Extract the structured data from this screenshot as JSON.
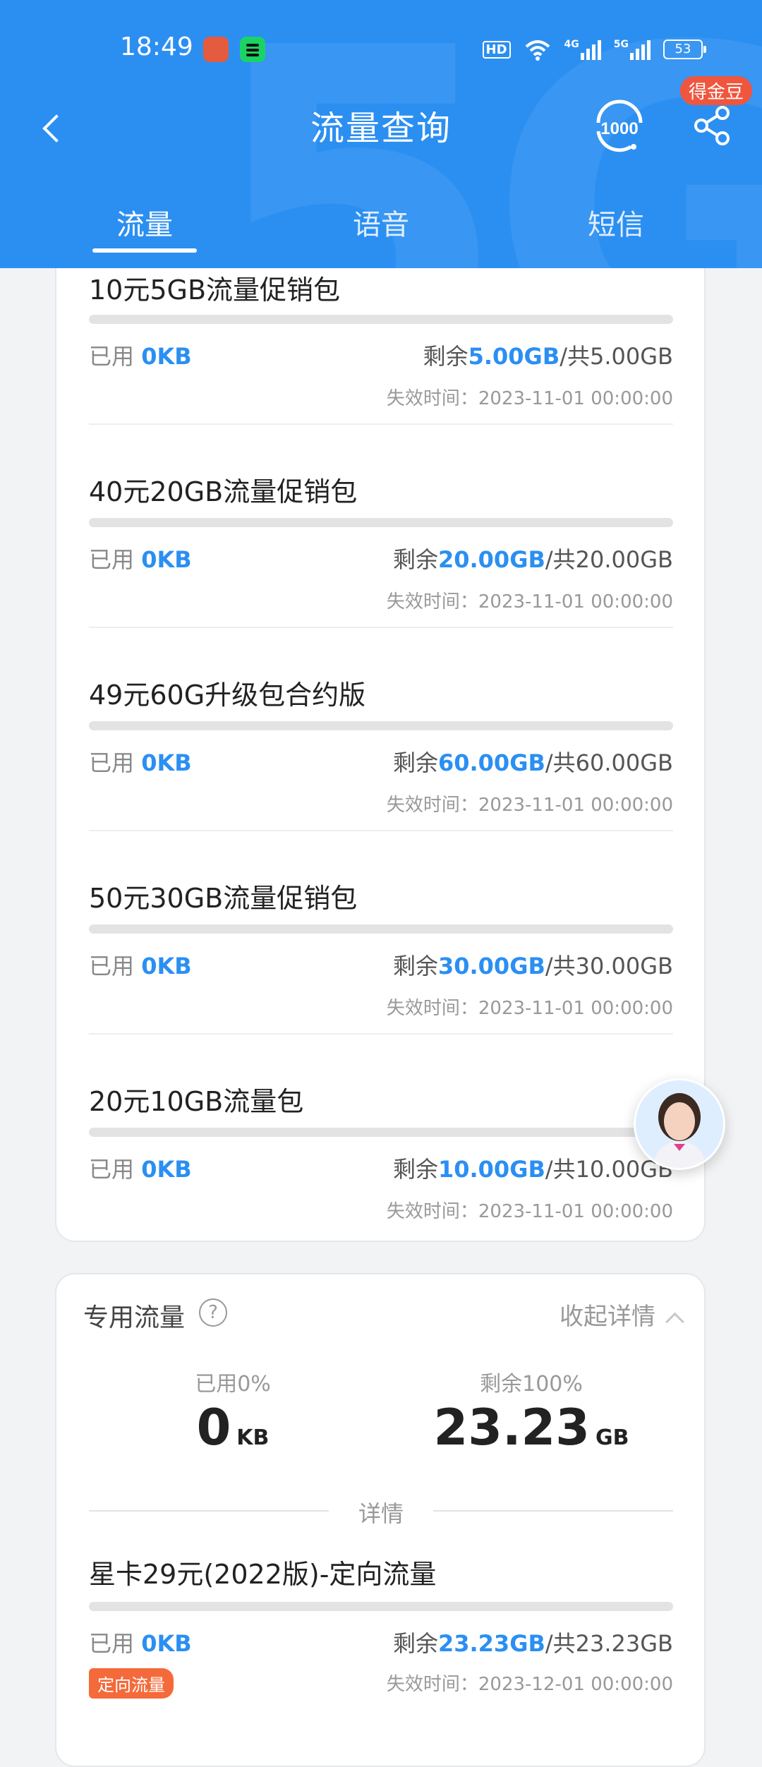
{
  "status_bar": {
    "time": "18:49",
    "hd": "HD",
    "net1": "4G",
    "net2": "5G",
    "battery": "53"
  },
  "header": {
    "title": "流量查询",
    "badge": "得金豆",
    "tabs": [
      {
        "label": "流量",
        "active": true
      },
      {
        "label": "语音",
        "active": false
      },
      {
        "label": "短信",
        "active": false
      }
    ],
    "accent_color": "#2b8ff2"
  },
  "packages": [
    {
      "name": "10元5GB流量促销包",
      "used_label": "已用",
      "used": "0KB",
      "remain_label": "剩余",
      "remain": "5.00GB",
      "total": "/共5.00GB",
      "expire": "失效时间：2023-11-01 00:00:00"
    },
    {
      "name": "40元20GB流量促销包",
      "used_label": "已用",
      "used": "0KB",
      "remain_label": "剩余",
      "remain": "20.00GB",
      "total": "/共20.00GB",
      "expire": "失效时间：2023-11-01 00:00:00"
    },
    {
      "name": "49元60G升级包合约版",
      "used_label": "已用",
      "used": "0KB",
      "remain_label": "剩余",
      "remain": "60.00GB",
      "total": "/共60.00GB",
      "expire": "失效时间：2023-11-01 00:00:00"
    },
    {
      "name": "50元30GB流量促销包",
      "used_label": "已用",
      "used": "0KB",
      "remain_label": "剩余",
      "remain": "30.00GB",
      "total": "/共30.00GB",
      "expire": "失效时间：2023-11-01 00:00:00"
    },
    {
      "name": "20元10GB流量包",
      "used_label": "已用",
      "used": "0KB",
      "remain_label": "剩余",
      "remain": "10.00GB",
      "total": "/共10.00GB",
      "expire": "失效时间：2023-11-01 00:00:00"
    }
  ],
  "dedicated": {
    "title": "专用流量",
    "help": "?",
    "collapse": "收起详情",
    "used_pct": "已用0%",
    "used_value": "0",
    "used_unit": "KB",
    "remain_pct": "剩余100%",
    "remain_value": "23.23",
    "remain_unit": "GB",
    "detail_label": "详情",
    "item": {
      "name": "星卡29元(2022版)-定向流量",
      "used_label": "已用",
      "used": "0KB",
      "remain_label": "剩余",
      "remain": "23.23GB",
      "total": "/共23.23GB",
      "tag": "定向流量",
      "expire": "失效时间：2023-12-01 00:00:00"
    }
  }
}
